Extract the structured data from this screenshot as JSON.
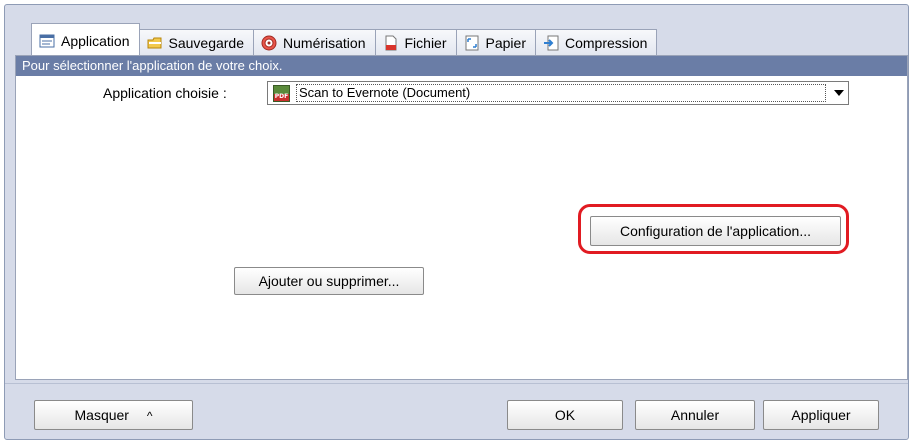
{
  "tabs": [
    {
      "label": "Application",
      "icon": "application-icon"
    },
    {
      "label": "Sauvegarde",
      "icon": "folder-icon"
    },
    {
      "label": "Numérisation",
      "icon": "scan-icon"
    },
    {
      "label": "Fichier",
      "icon": "file-icon"
    },
    {
      "label": "Papier",
      "icon": "paper-icon"
    },
    {
      "label": "Compression",
      "icon": "compression-icon"
    }
  ],
  "info_text": "Pour sélectionner l'application de votre choix.",
  "application": {
    "label": "Application choisie :",
    "selected": "Scan to Evernote (Document)",
    "icon_text": "PDF"
  },
  "buttons": {
    "config": "Configuration de l'application...",
    "add_remove": "Ajouter ou supprimer...",
    "masquer": "Masquer",
    "masquer_chevron": "^",
    "ok": "OK",
    "annuler": "Annuler",
    "appliquer": "Appliquer"
  },
  "colors": {
    "info_bar": "#6a7da6",
    "highlight": "#e11b22",
    "window_bg": "#d6dbe9"
  }
}
